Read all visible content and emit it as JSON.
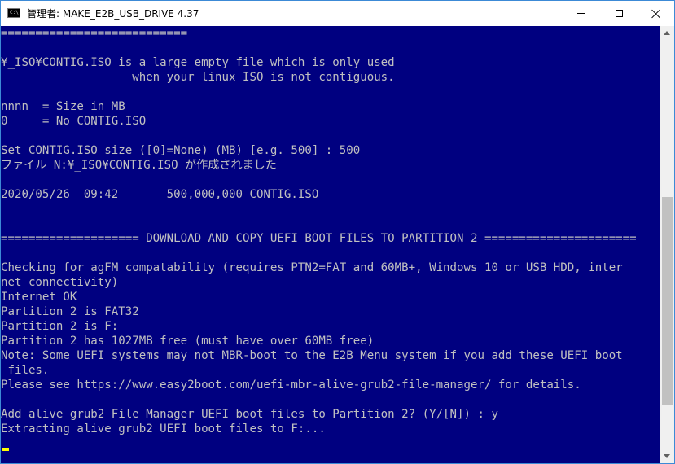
{
  "window": {
    "title": "管理者:  MAKE_E2B_USB_DRIVE 4.37",
    "icon_text": "C:\\",
    "icon": "console-app-icon",
    "controls": [
      "minimize-icon",
      "maximize-icon",
      "close-icon"
    ]
  },
  "console": {
    "background": "#000080",
    "foreground": "#c0c0c0",
    "cursor_color": "#ffff00",
    "lines": [
      "===========================",
      "",
      "¥_ISO¥CONTIG.ISO is a large empty file which is only used",
      "                   when your linux ISO is not contiguous.",
      "",
      "nnnn  = Size in MB",
      "0     = No CONTIG.ISO",
      "",
      "Set CONTIG.ISO size ([0]=None) (MB) [e.g. 500] : 500",
      "ファイル N:¥_ISO¥CONTIG.ISO が作成されました",
      "",
      "2020/05/26  09:42       500,000,000 CONTIG.ISO",
      "",
      "",
      "==================== DOWNLOAD AND COPY UEFI BOOT FILES TO PARTITION 2 ======================",
      "",
      "Checking for agFM compatability (requires PTN2=FAT and 60MB+, Windows 10 or USB HDD, inter",
      "net connectivity)",
      "Internet OK",
      "Partition 2 is FAT32",
      "Partition 2 is F:",
      "Partition 2 has 1027MB free (must have over 60MB free)",
      "Note: Some UEFI systems may not MBR-boot to the E2B Menu system if you add these UEFI boot",
      " files.",
      "Please see https://www.easy2boot.com/uefi-mbr-alive-grub2-file-manager/ for details.",
      "",
      "Add alive grub2 File Manager UEFI boot files to Partition 2? (Y/[N]) : y",
      "Extracting alive grub2 UEFI boot files to F:..."
    ]
  },
  "scrollbar": {
    "position": 0.78
  }
}
